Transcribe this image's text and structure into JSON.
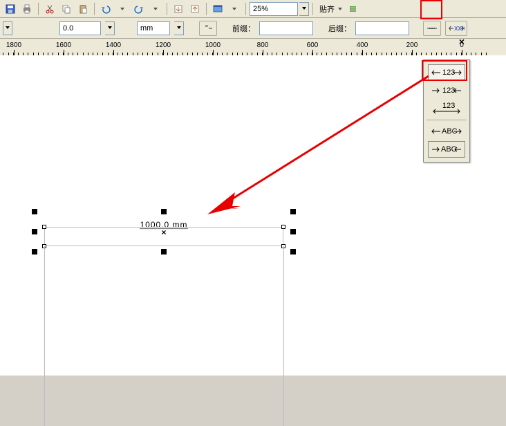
{
  "toolbar": {
    "zoom": "25%",
    "zoom_placeholder": "",
    "snap_label": "贴齐"
  },
  "propbar": {
    "value": "0.0",
    "unit": "mm",
    "prefix_label": "前缀：",
    "prefix_value": "",
    "suffix_label": "后缀：",
    "suffix_value": ""
  },
  "ruler": {
    "values": [
      "1800",
      "1600",
      "1400",
      "1200",
      "1000",
      "800",
      "600",
      "400",
      "200",
      "0"
    ]
  },
  "dimension": {
    "text": "1000.0 mm"
  },
  "flyout": {
    "items": [
      {
        "name": "dim-style-text-between",
        "label": "123"
      },
      {
        "name": "dim-style-text-between-arrows",
        "label": "123"
      },
      {
        "name": "dim-style-text-above",
        "label": "123"
      },
      {
        "name": "dim-style-abc-between",
        "label": "ABC"
      },
      {
        "name": "dim-style-abc-between-arrows",
        "label": "ABC"
      }
    ]
  }
}
